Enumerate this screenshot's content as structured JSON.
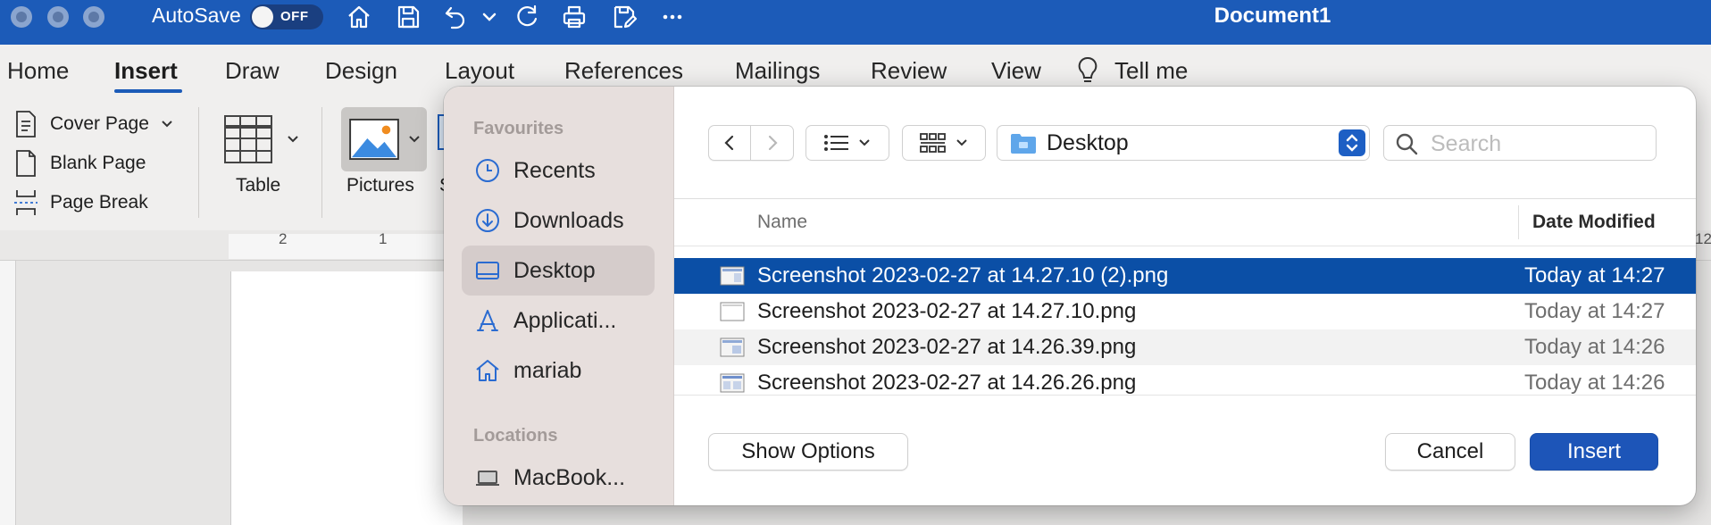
{
  "titlebar": {
    "autosave_label": "AutoSave",
    "autosave_state": "OFF",
    "document_title": "Document1",
    "icons": [
      "home-icon",
      "save-icon",
      "undo-icon",
      "chevron-down-icon",
      "redo-icon",
      "print-icon",
      "save-as-icon",
      "more-icon"
    ]
  },
  "ribbon_tabs": {
    "items": [
      "Home",
      "Insert",
      "Draw",
      "Design",
      "Layout",
      "References",
      "Mailings",
      "Review",
      "View"
    ],
    "active": "Insert",
    "tell_me": "Tell me"
  },
  "ribbon": {
    "pages_group": {
      "cover_page": "Cover Page",
      "blank_page": "Blank Page",
      "page_break": "Page Break"
    },
    "table_label": "Table",
    "pictures_label": "Pictures",
    "shapes_partial": "S"
  },
  "ruler": {
    "numbers": [
      "2",
      "1"
    ],
    "right_number": "12"
  },
  "dialog": {
    "sidebar": {
      "favourites_heading": "Favourites",
      "favourites": [
        {
          "label": "Recents",
          "icon": "clock-icon"
        },
        {
          "label": "Downloads",
          "icon": "download-icon"
        },
        {
          "label": "Desktop",
          "icon": "desktop-icon",
          "selected": true
        },
        {
          "label": "Applicati...",
          "icon": "applications-icon"
        },
        {
          "label": "mariab",
          "icon": "home-icon"
        }
      ],
      "locations_heading": "Locations",
      "locations": [
        {
          "label": "MacBook...",
          "icon": "laptop-icon"
        }
      ]
    },
    "location": "Desktop",
    "search_placeholder": "Search",
    "columns": {
      "name": "Name",
      "date_modified": "Date Modified"
    },
    "files": [
      {
        "name": "Screenshot 2023-02-27 at 14.27.10 (2).png",
        "date": "Today at 14:27",
        "selected": true
      },
      {
        "name": "Screenshot 2023-02-27 at 14.27.10.png",
        "date": "Today at 14:27"
      },
      {
        "name": "Screenshot 2023-02-27 at 14.26.39.png",
        "date": "Today at 14:26"
      },
      {
        "name": "Screenshot 2023-02-27 at 14.26.26.png",
        "date": "Today at 14:26"
      }
    ],
    "buttons": {
      "show_options": "Show Options",
      "cancel": "Cancel",
      "insert": "Insert"
    }
  },
  "colors": {
    "titlebar_blue": "#1c5bb8",
    "selection_blue": "#0b4fa6",
    "primary_button": "#1d55b8",
    "sidebar_bg": "#e7dfdd"
  }
}
